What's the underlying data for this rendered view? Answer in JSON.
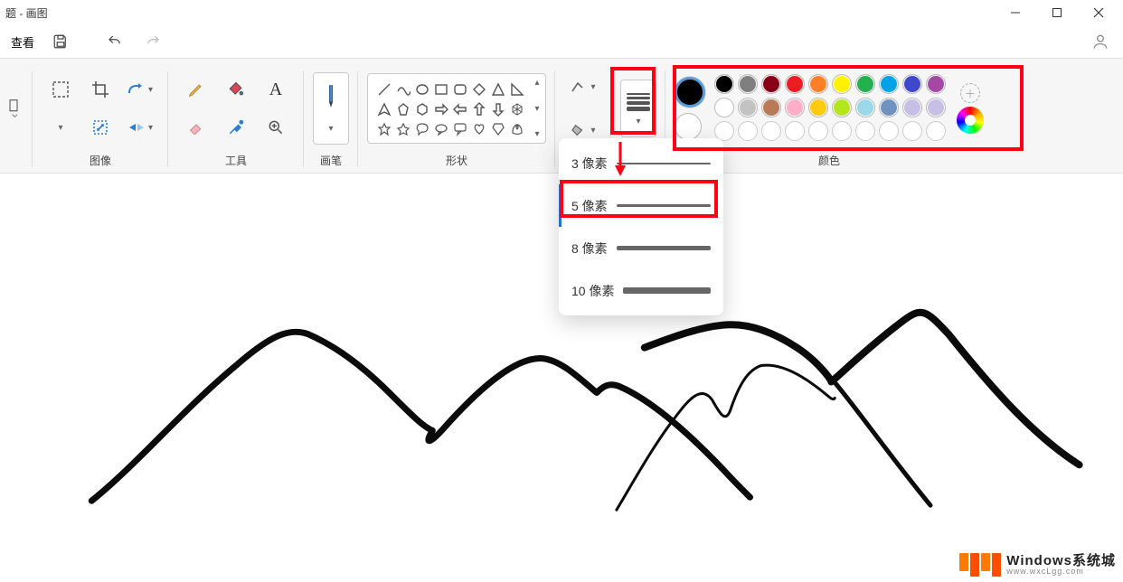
{
  "title": "题 - 画图",
  "toolbar": {
    "view": "查看"
  },
  "groups": {
    "image": "图像",
    "tools": "工具",
    "brushes": "画笔",
    "shapes": "形状",
    "colors": "颜色"
  },
  "size_menu": {
    "items": [
      {
        "label": "3 像素",
        "px": 2
      },
      {
        "label": "5 像素",
        "px": 3
      },
      {
        "label": "8 像素",
        "px": 5
      },
      {
        "label": "10 像素",
        "px": 7
      }
    ],
    "selected_index": 1
  },
  "palette_row1": [
    "#000000",
    "#7f7f7f",
    "#880015",
    "#ed1c24",
    "#ff7f27",
    "#fff200",
    "#22b14c",
    "#00a2e8",
    "#3f48cc",
    "#a349a4"
  ],
  "palette_row2": [
    "#ffffff",
    "#c3c3c3",
    "#b97a57",
    "#ffaec9",
    "#ffc90e",
    "#b5e61d",
    "#99d9ea",
    "#7092be",
    "#c8bfe7",
    "#c8bfe7"
  ],
  "current_color1": "#000000",
  "current_color2": "#ffffff",
  "watermark": {
    "line1": "Windows系统城",
    "line2": "www.wxcLgg.com"
  }
}
